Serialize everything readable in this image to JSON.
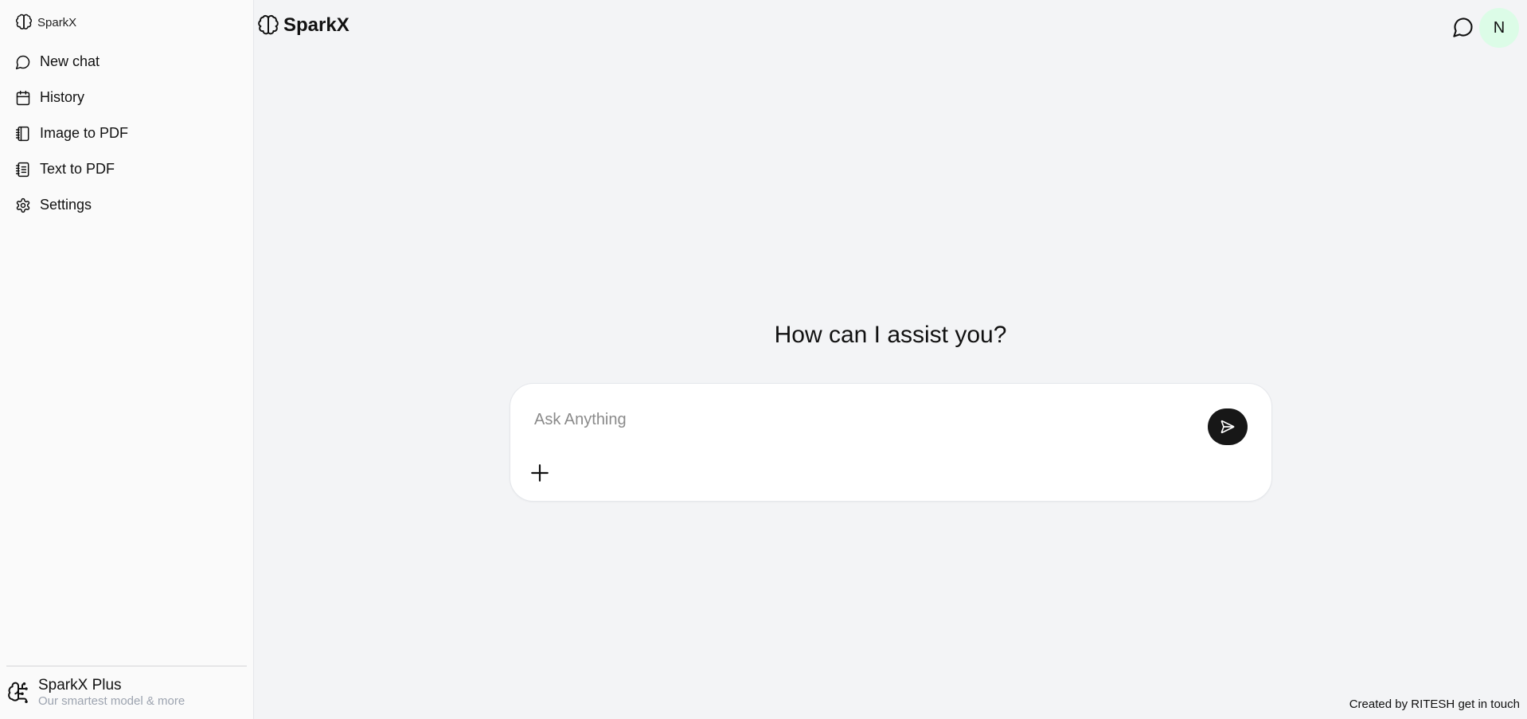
{
  "sidebar": {
    "brand": "SparkX",
    "items": [
      {
        "label": "New chat",
        "icon": "chat-bubble-icon"
      },
      {
        "label": "History",
        "icon": "calendar-icon"
      },
      {
        "label": "Image to PDF",
        "icon": "notebook-icon"
      },
      {
        "label": "Text to PDF",
        "icon": "document-list-icon"
      },
      {
        "label": "Settings",
        "icon": "gear-icon"
      }
    ],
    "plus": {
      "title": "SparkX Plus",
      "subtitle": "Our smartest model & more",
      "icon": "brain-circuit-icon"
    }
  },
  "header": {
    "brand": "SparkX",
    "avatar_initial": "N",
    "avatar_color": "#dcfce7"
  },
  "main": {
    "headline": "How can I assist you?",
    "composer": {
      "placeholder": "Ask Anything",
      "value": ""
    }
  },
  "footer": {
    "created_by": "Created by RITESH",
    "get_in_touch": "get in touch"
  },
  "colors": {
    "background": "#f3f4f6",
    "sidebar": "#fafafa",
    "send_button": "#171717"
  }
}
